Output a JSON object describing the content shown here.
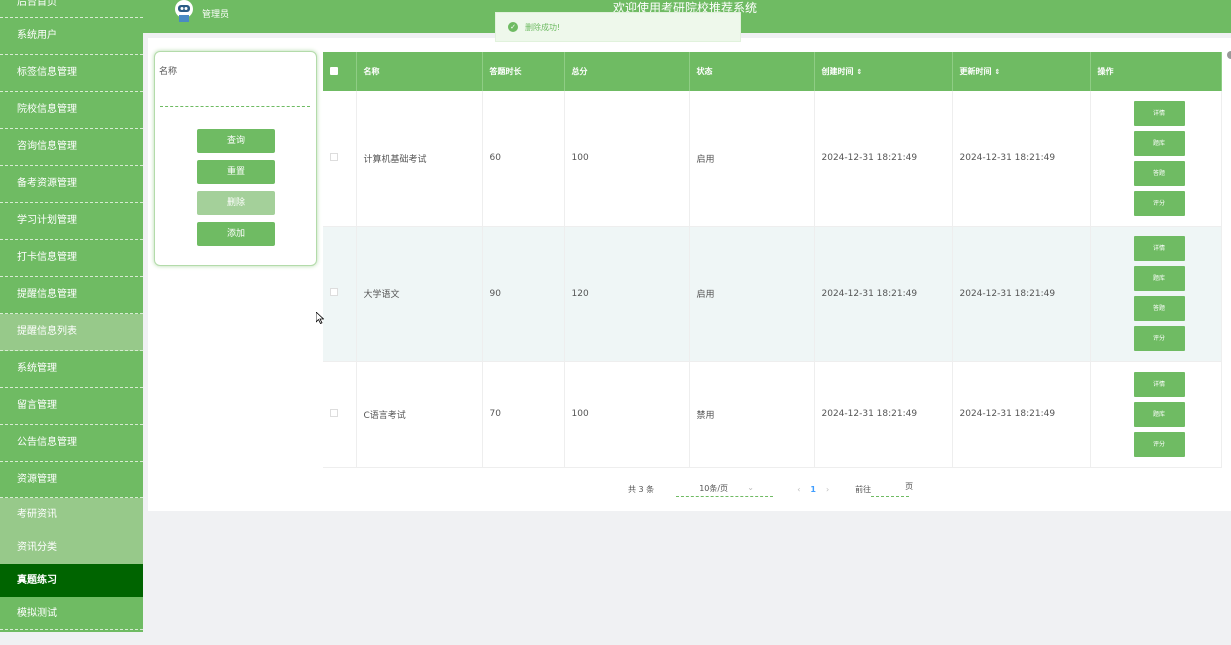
{
  "header": {
    "role": "管理员",
    "welcome": "欢迎使用考研院校推荐系统"
  },
  "toast": {
    "text": "删除成功!"
  },
  "sidebar": {
    "items": [
      {
        "label": "后台首页"
      },
      {
        "label": "系统用户"
      },
      {
        "label": "标签信息管理"
      },
      {
        "label": "院校信息管理"
      },
      {
        "label": "咨询信息管理"
      },
      {
        "label": "备考资源管理"
      },
      {
        "label": "学习计划管理"
      },
      {
        "label": "打卡信息管理"
      },
      {
        "label": "提醒信息管理"
      },
      {
        "label": "提醒信息列表"
      },
      {
        "label": "系统管理"
      },
      {
        "label": "留言管理"
      },
      {
        "label": "公告信息管理"
      },
      {
        "label": "资源管理"
      },
      {
        "label": "考研资讯"
      },
      {
        "label": "资讯分类"
      },
      {
        "label": "真题练习"
      },
      {
        "label": "模拟测试"
      }
    ]
  },
  "search": {
    "label": "名称",
    "placeholder": "",
    "query": "查询",
    "reset": "重置",
    "delete": "删除",
    "add": "添加"
  },
  "table": {
    "columns": [
      "名称",
      "答题时长",
      "总分",
      "状态",
      "创建时间",
      "更新时间",
      "操作"
    ],
    "rows": [
      {
        "name": "计算机基础考试",
        "duration": "60",
        "score": "100",
        "status": "启用",
        "created": "2024-12-31 18:21:49",
        "updated": "2024-12-31 18:21:49",
        "ops": [
          "详情",
          "题库",
          "答题",
          "评分"
        ]
      },
      {
        "name": "大学语文",
        "duration": "90",
        "score": "120",
        "status": "启用",
        "created": "2024-12-31 18:21:49",
        "updated": "2024-12-31 18:21:49",
        "ops": [
          "详情",
          "题库",
          "答题",
          "评分"
        ]
      },
      {
        "name": "C语言考试",
        "duration": "70",
        "score": "100",
        "status": "禁用",
        "created": "2024-12-31 18:21:49",
        "updated": "2024-12-31 18:21:49",
        "ops": [
          "详情",
          "题库",
          "评分"
        ]
      }
    ]
  },
  "pager": {
    "total": "共 3 条",
    "size": "10条/页",
    "page": "1",
    "goto": "前往",
    "unit": "页"
  },
  "colors": {
    "primary": "#6fbb63",
    "active": "#006400",
    "light": "#97c98a"
  }
}
